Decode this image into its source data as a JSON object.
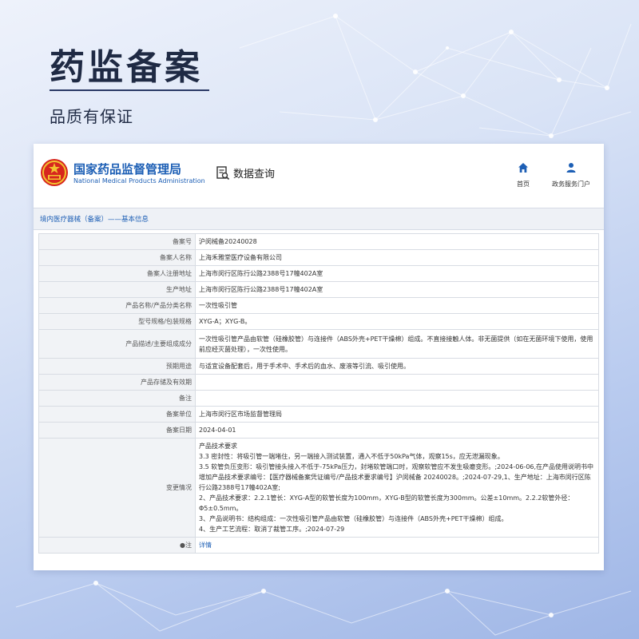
{
  "hero": {
    "title": "药监备案",
    "subtitle": "品质有保证"
  },
  "site": {
    "name_cn": "国家药品监督管理局",
    "name_en": "National Medical Products Administration",
    "data_query_label": "数据查询",
    "nav": [
      {
        "label": "首页",
        "icon": "home-icon"
      },
      {
        "label": "政务服务门户",
        "icon": "user-icon"
      }
    ]
  },
  "breadcrumb": "境内医疗器械（备案）——基本信息",
  "record": {
    "rows": [
      {
        "label": "备案号",
        "value": "沪闵械备20240028"
      },
      {
        "label": "备案人名称",
        "value": "上海禾雅堂医疗设备有限公司"
      },
      {
        "label": "备案人注册地址",
        "value": "上海市闵行区陈行公路2388号17幢402A室"
      },
      {
        "label": "生产地址",
        "value": "上海市闵行区陈行公路2388号17幢402A室"
      },
      {
        "label": "产品名称/产品分类名称",
        "value": "一次性吸引管"
      },
      {
        "label": "型号规格/包装规格",
        "value": "XYG-A；XYG-B。"
      },
      {
        "label": "产品描述/主要组成成分",
        "value": "一次性吸引管产品由软管（硅橡胶管）与连接件（ABS外壳+PET干燥棉）组成。不直接接触人体。非无菌提供（如在无菌环境下使用，使用前应经灭菌处理），一次性使用。"
      },
      {
        "label": "预期用途",
        "value": "与适宜设备配套后，用于手术中、手术后的血水、废液等引流、吸引使用。"
      },
      {
        "label": "产品存储及有效期",
        "value": ""
      },
      {
        "label": "备注",
        "value": ""
      },
      {
        "label": "备案单位",
        "value": "上海市闵行区市场监督管理局"
      },
      {
        "label": "备案日期",
        "value": "2024-04-01"
      }
    ],
    "changes_label": "变更情况",
    "changes": [
      "产品技术要求",
      "3.3 密封性：将吸引管一端堵住，另一端接入测试装置，通入不低于50kPa气体，观察15s，应无泄漏现象。",
      "3.5 软管负压变形：吸引管接头接入不低于-75kPa压力，封堵软管端口时，观察软管应不发生吸瘪变形。;2024-06-06,在产品使用说明书中增加产品技术要求编号：【医疗器械备案凭证编号/产品技术要求编号】沪闵械备 20240028。;2024-07-29,1、生产地址：上海市闵行区陈行公路2388号17幢402A室;",
      "2、产品技术要求：2.2.1管长：XYG-A型的软管长度为100mm，XYG-B型的软管长度为300mm。公差±10mm。2.2.2软管外径：Φ5±0.5mm。",
      "3、产品说明书：结构组成：一次性吸引管产品由软管（硅橡胶管）与连接件（ABS外壳+PET干燥棉）组成。",
      "4、生产工艺流程：取消了裁管工序。;2024-07-29"
    ],
    "note_label": "注",
    "note_link": "详情"
  },
  "colors": {
    "brand_blue": "#1d5fb5",
    "label_bg": "#f1f3f6"
  }
}
